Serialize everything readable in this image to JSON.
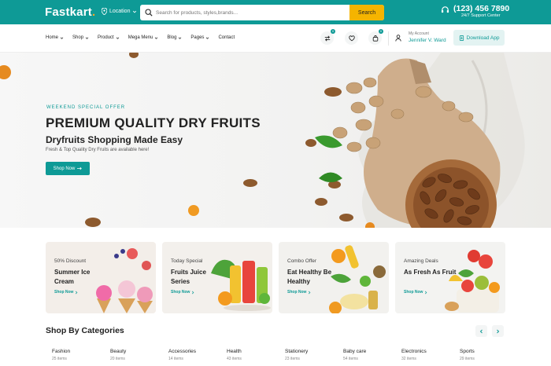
{
  "header": {
    "logo": "Fastkart",
    "logo_dot": ".",
    "location_label": "Location",
    "search_placeholder": "Search for products, styles,brands...",
    "search_button": "Search",
    "phone": "(123) 456 7890",
    "support": "24/7 Support Center"
  },
  "nav": {
    "items": [
      {
        "label": "Home"
      },
      {
        "label": "Shop"
      },
      {
        "label": "Product"
      },
      {
        "label": "Mega Menu"
      },
      {
        "label": "Blog"
      },
      {
        "label": "Pages"
      },
      {
        "label": "Contact"
      }
    ],
    "compare_count": "0",
    "cart_count": "0",
    "account_label": "My Account",
    "account_name": "Jennifer V. Ward",
    "download": "Download App"
  },
  "hero": {
    "tag": "WEEKEND SPECIAL OFFER",
    "title": "PREMIUM QUALITY DRY FRUITS",
    "subtitle": "Dryfruits Shopping Made Easy",
    "description": "Fresh & Top Quality Dry Fruits are available here!",
    "button": "Shop Now"
  },
  "promos": [
    {
      "small": "50% Discount",
      "title": "Summer Ice Cream",
      "link": "Shop Now"
    },
    {
      "small": "Today Special",
      "title": "Fruits Juice Series",
      "link": "Shop Now"
    },
    {
      "small": "Combo Offer",
      "title": "Eat Healthy Be Healthy",
      "link": "Shop Now"
    },
    {
      "small": "Amazing Deals",
      "title": "As Fresh As Fruit",
      "link": "Shop Now"
    }
  ],
  "categories": {
    "title": "Shop By Categories",
    "items": [
      {
        "name": "Fashion",
        "count": "25 items"
      },
      {
        "name": "Beauty",
        "count": "20 items"
      },
      {
        "name": "Accessories",
        "count": "14 items"
      },
      {
        "name": "Health",
        "count": "43 items"
      },
      {
        "name": "Stationery",
        "count": "23 items"
      },
      {
        "name": "Baby care",
        "count": "54 items"
      },
      {
        "name": "Electronics",
        "count": "32 items"
      },
      {
        "name": "Sports",
        "count": "29 items"
      }
    ]
  },
  "colors": {
    "primary": "#0e9a96",
    "search_button": "#f5b400",
    "accent": "#f5a623"
  }
}
